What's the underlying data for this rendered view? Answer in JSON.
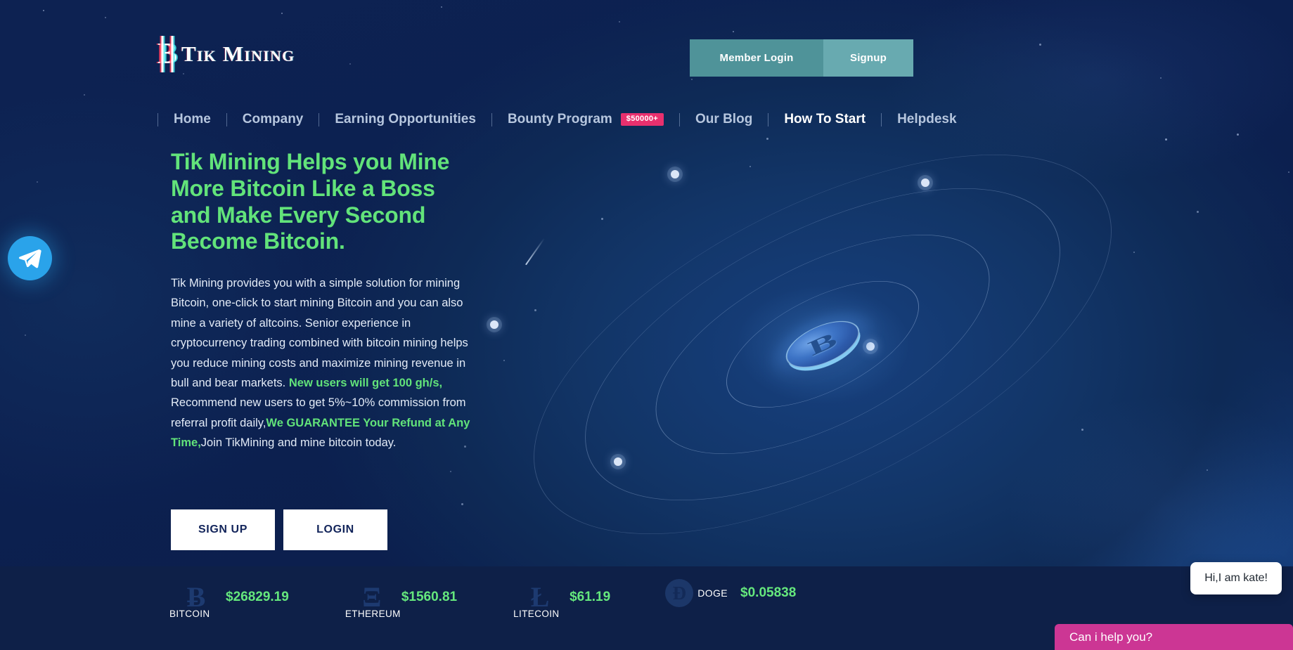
{
  "brand": {
    "symbol": "B",
    "name": "Tik Mining"
  },
  "auth": {
    "login_label": "Member Login",
    "signup_label": "Signup",
    "login_color": "#4f9399",
    "signup_color": "#68aab0"
  },
  "nav": {
    "items": [
      {
        "label": "Home",
        "active": false,
        "badge": ""
      },
      {
        "label": "Company",
        "active": false,
        "badge": ""
      },
      {
        "label": "Earning Opportunities",
        "active": false,
        "badge": ""
      },
      {
        "label": "Bounty Program",
        "active": false,
        "badge": "$50000+"
      },
      {
        "label": "Our Blog",
        "active": false,
        "badge": ""
      },
      {
        "label": "How To Start",
        "active": true,
        "badge": ""
      },
      {
        "label": "Helpdesk",
        "active": false,
        "badge": ""
      }
    ],
    "badge_color": "#e8306e"
  },
  "hero": {
    "heading": "Tik Mining Helps you Mine More Bitcoin Like a Boss and Make Every Second Become Bitcoin.",
    "heading_color": "#62e37a",
    "paragraph_1": "Tik Mining provides you with a simple solution for mining Bitcoin, one-click to start mining Bitcoin and you can also mine a variety of altcoins. Senior experience in cryptocurrency trading combined with bitcoin mining helps you reduce mining costs and maximize mining revenue in bull and bear markets.",
    "highlight_1": "New users will get 100 gh/s,",
    "paragraph_2": " Recommend new users to get 5%~10% commission from referral profit daily,",
    "highlight_2": "We GUARANTEE Your Refund at Any Time,",
    "paragraph_3": "Join TikMining and mine bitcoin today.",
    "cta_signup": "SIGN UP",
    "cta_login": "LOGIN"
  },
  "graphic": {
    "coin_symbol": "B",
    "alt": "3d bitcoin coin with orbit rings"
  },
  "ticker": {
    "coins": [
      {
        "name": "BITCOIN",
        "symbol": "Ƀ",
        "price": "$26829.19"
      },
      {
        "name": "ETHEREUM",
        "symbol": "Ξ",
        "price": "$1560.81"
      },
      {
        "name": "LITECOIN",
        "symbol": "Ł",
        "price": "$61.19"
      },
      {
        "name": "DOGE",
        "symbol": "Ð",
        "price": "$0.05838"
      }
    ],
    "price_color": "#65e87d"
  },
  "widgets": {
    "telegram_label": "telegram",
    "chat_greeting": "Hi,I am kate!",
    "chat_prompt": "Can i help you?",
    "chat_prompt_color": "#cc3694"
  }
}
